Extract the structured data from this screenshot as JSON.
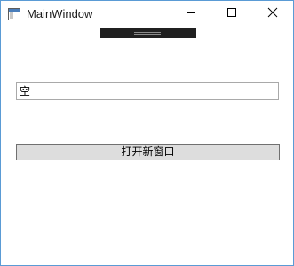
{
  "window": {
    "title": "MainWindow",
    "accent_color": "#5a9bd5",
    "icon": "app-window-icon"
  },
  "caption_buttons": {
    "minimize_icon": "minimize-icon",
    "maximize_icon": "maximize-icon",
    "close_icon": "close-icon"
  },
  "debug_toolbar": {
    "background": "#202020"
  },
  "content": {
    "text_field_value": "空",
    "open_button_label": "打开新窗口"
  }
}
